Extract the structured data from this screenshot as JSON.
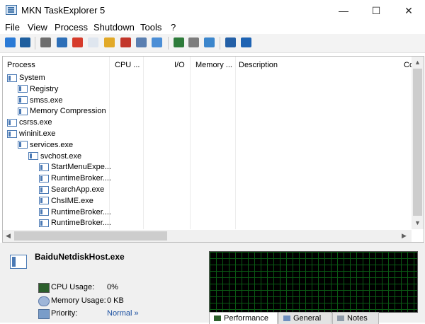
{
  "window": {
    "title": "MKN TaskExplorer 5"
  },
  "menu": [
    "File",
    "View",
    "Process",
    "Shutdown",
    "Tools",
    "?"
  ],
  "toolbar": [
    {
      "icon": "refresh-icon",
      "color": "#2a7ad6"
    },
    {
      "icon": "monitor-icon",
      "color": "#1f5f9f"
    },
    {
      "icon": "process-tree-icon",
      "color": "#6e6e6e"
    },
    {
      "icon": "window-list-icon",
      "color": "#2d6fb8"
    },
    {
      "icon": "kill-process-icon",
      "color": "#d63b2b"
    },
    {
      "icon": "blank-window-icon",
      "color": "#dfe6ef"
    },
    {
      "icon": "folder-icon",
      "color": "#e2a927"
    },
    {
      "icon": "delete-icon",
      "color": "#c2362b"
    },
    {
      "icon": "properties-icon",
      "color": "#5a7fb1"
    },
    {
      "icon": "search-icon",
      "color": "#4b8ed6"
    },
    {
      "icon": "network-icon",
      "color": "#2e7c3b"
    },
    {
      "icon": "inspect-icon",
      "color": "#7d7d7d"
    },
    {
      "icon": "checklist-icon",
      "color": "#3c86cc"
    },
    {
      "icon": "msn-icon",
      "color": "#2460a7"
    },
    {
      "icon": "help-icon",
      "color": "#1e63b3"
    }
  ],
  "columns": [
    "Process",
    "CPU ...",
    "I/O",
    "Memory ...",
    "Description",
    "Co"
  ],
  "processes": [
    {
      "name": "System",
      "level": 0
    },
    {
      "name": "Registry",
      "level": 1
    },
    {
      "name": "smss.exe",
      "level": 1
    },
    {
      "name": "Memory Compression",
      "level": 1
    },
    {
      "name": "csrss.exe",
      "level": 0
    },
    {
      "name": "wininit.exe",
      "level": 0
    },
    {
      "name": "services.exe",
      "level": 1
    },
    {
      "name": "svchost.exe",
      "level": 2
    },
    {
      "name": "StartMenuExpe...",
      "level": 3
    },
    {
      "name": "RuntimeBroker....",
      "level": 3
    },
    {
      "name": "SearchApp.exe",
      "level": 3
    },
    {
      "name": "ChsIME.exe",
      "level": 3
    },
    {
      "name": "RuntimeBroker....",
      "level": 3
    },
    {
      "name": "RuntimeBroker....",
      "level": 3
    }
  ],
  "details": {
    "selected_process": "BaiduNetdiskHost.exe",
    "cpu_label": "CPU Usage:",
    "cpu_value": "0%",
    "memory_label": "Memory Usage:",
    "memory_value": "0 KB",
    "priority_label": "Priority:",
    "priority_value": "Normal »"
  },
  "tabs": [
    "Performance",
    "General",
    "Notes"
  ],
  "colors": {
    "priority_link": "#1a4fa0",
    "graph_grid": "#0a5a14",
    "graph_bg": "#000000"
  }
}
